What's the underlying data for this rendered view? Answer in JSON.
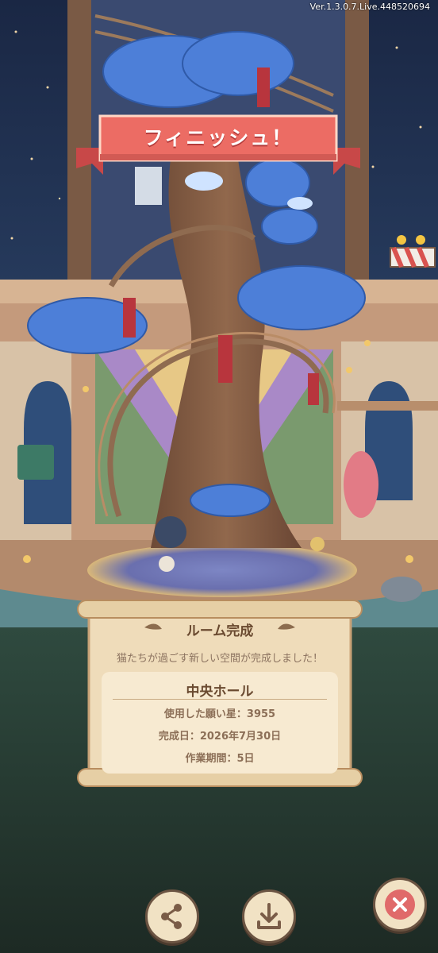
{
  "game": {
    "version": "Ver.1.3.0.7.Live.448520694"
  },
  "banner": {
    "text": "フィニッシュ！"
  },
  "room_panel": {
    "title": "ルーム完成",
    "subtitle": "猫たちが過ごす新しい空間が完成しました！",
    "room_name": "中央ホール",
    "stars_used": "使用した願い星：3955",
    "completion_date": "完成日：2026年7月30日",
    "work_period": "作業期間：5日"
  },
  "buttons": {
    "share_icon": "share-icon",
    "download_icon": "download-icon",
    "close_icon": "close-icon"
  },
  "colors": {
    "night_sky": "#1c2a45",
    "tree_trunk": "#8a6248",
    "leaves": "#4a7bd6",
    "banner_red": "#e8645c",
    "parchment": "#efdcba",
    "close_red": "#e06a6a"
  }
}
